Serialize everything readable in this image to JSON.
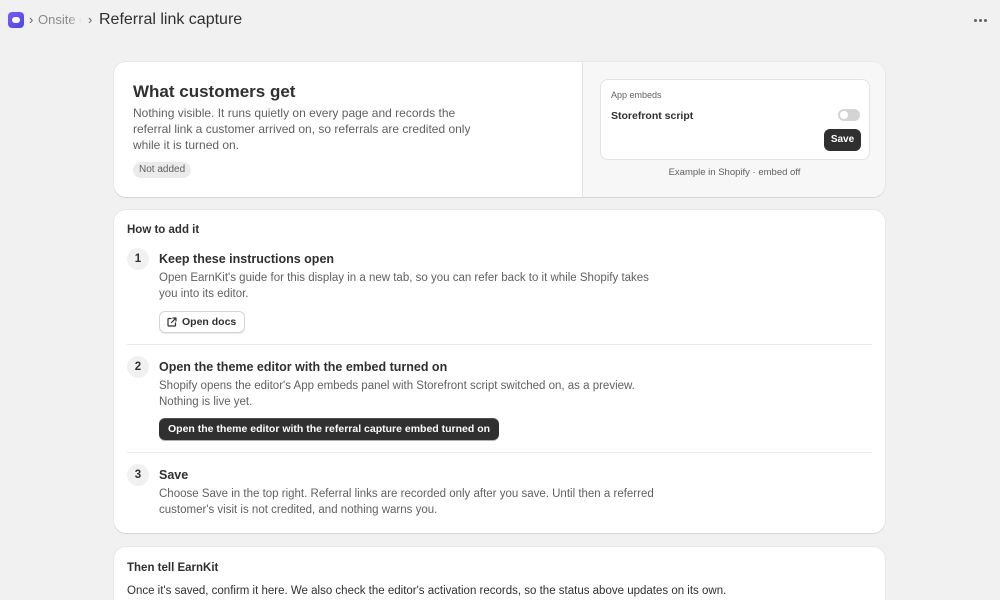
{
  "header": {
    "breadcrumb_parent": "Onsite d",
    "breadcrumb_sep": "›",
    "title": "Referral link capture"
  },
  "customers": {
    "title": "What customers get",
    "description": "Nothing visible. It runs quietly on every page and records the referral link a customer arrived on, so referrals are credited only while it is turned on.",
    "status_badge": "Not added"
  },
  "embed_preview": {
    "section_label": "App embeds",
    "script_name": "Storefront script",
    "toggle_on": false,
    "save_label": "Save",
    "caption": "Example in Shopify · embed off"
  },
  "steps": {
    "heading": "How to add it",
    "items": [
      {
        "number": "1",
        "title": "Keep these instructions open",
        "description": "Open EarnKit's guide for this display in a new tab, so you can refer back to it while Shopify takes you into its editor.",
        "button_label": "Open docs",
        "button_icon": "external-link-icon"
      },
      {
        "number": "2",
        "title": "Open the theme editor with the embed turned on",
        "description": "Shopify opens the editor's App embeds panel with Storefront script switched on, as a preview. Nothing is live yet.",
        "button_label": "Open the theme editor with the referral capture embed turned on"
      },
      {
        "number": "3",
        "title": "Save",
        "description": "Choose Save in the top right. Referral links are recorded only after you save. Until then a referred customer's visit is not credited, and nothing warns you."
      }
    ]
  },
  "confirm": {
    "heading": "Then tell EarnKit",
    "description": "Once it's saved, confirm it here. We also check the editor's activation records, so the status above updates on its own."
  },
  "colors": {
    "background": "#f1f1f1",
    "card": "#ffffff",
    "primary_button": "#303030",
    "accent_logo": "#6d4ef2"
  }
}
